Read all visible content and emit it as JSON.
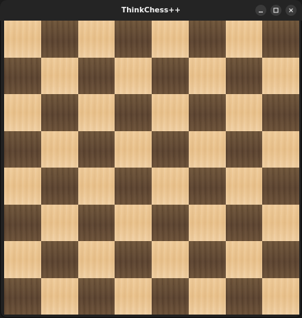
{
  "window": {
    "title": "ThinkChess++",
    "controls": [
      {
        "name": "minimize-button",
        "icon": "minimize-icon"
      },
      {
        "name": "maximize-button",
        "icon": "maximize-icon"
      },
      {
        "name": "close-button",
        "icon": "close-icon"
      }
    ]
  },
  "board": {
    "files": 8,
    "ranks": 8,
    "light_color": "#ecc693",
    "dark_color": "#63492f",
    "pieces": []
  }
}
